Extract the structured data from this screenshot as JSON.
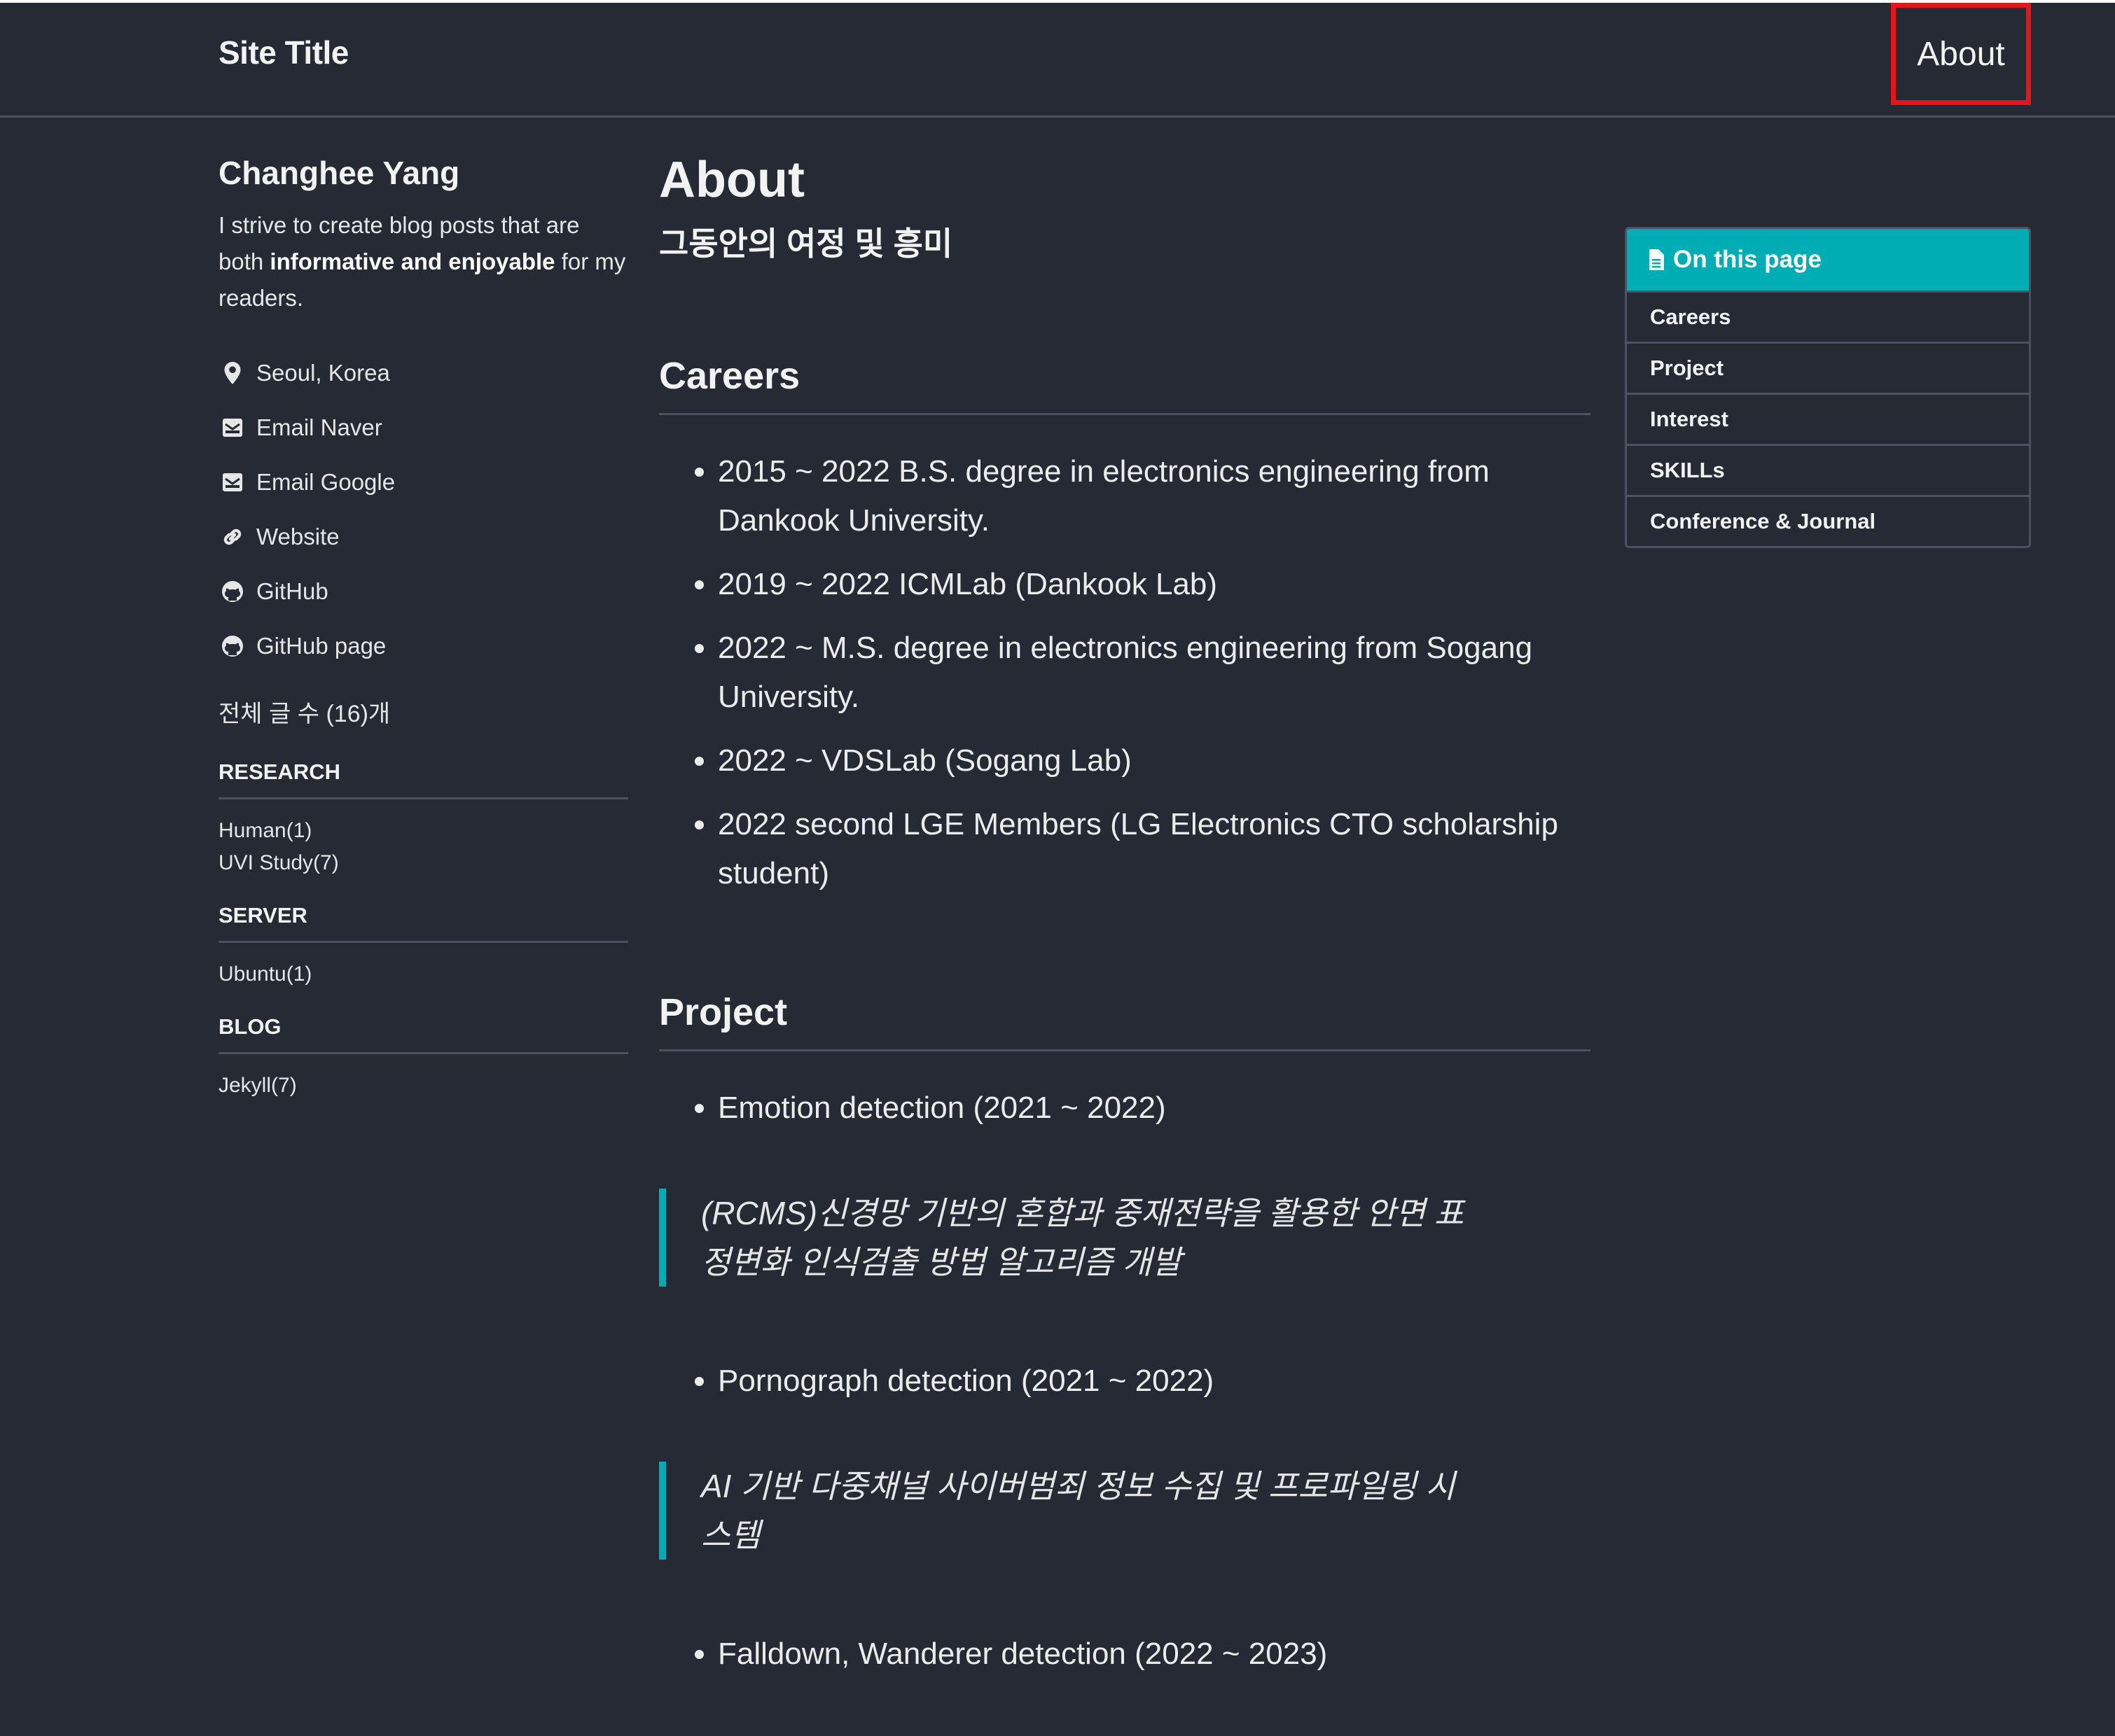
{
  "masthead": {
    "site_title": "Site Title",
    "nav": [
      {
        "label": "About"
      }
    ]
  },
  "sidebar": {
    "author_name": "Changhee Yang",
    "bio_parts": [
      "I strive to create blog posts that are both ",
      "informative and enjoyable",
      " for my readers."
    ],
    "links": [
      {
        "icon": "map-marker-icon",
        "label": "Seoul, Korea"
      },
      {
        "icon": "envelope-icon",
        "label": "Email Naver"
      },
      {
        "icon": "envelope-icon",
        "label": "Email Google"
      },
      {
        "icon": "link-icon",
        "label": "Website"
      },
      {
        "icon": "github-icon",
        "label": "GitHub"
      },
      {
        "icon": "github-icon",
        "label": "GitHub page"
      }
    ],
    "post_count": "전체 글 수 (16)개",
    "categories": [
      {
        "title": "RESEARCH",
        "items": [
          "Human(1)",
          "UVI Study(7)"
        ]
      },
      {
        "title": "SERVER",
        "items": [
          "Ubuntu(1)"
        ]
      },
      {
        "title": "BLOG",
        "items": [
          "Jekyll(7)"
        ]
      }
    ]
  },
  "main": {
    "title": "About",
    "subtitle": "그동안의 여정 및 흥미",
    "sections": [
      {
        "heading": "Careers",
        "items": [
          "2015 ~ 2022 B.S. degree in electronics engineering from Dankook University.",
          "2019 ~ 2022 ICMLab (Dankook Lab)",
          "2022 ~ M.S. degree in electronics engineering from Sogang University.",
          "2022 ~ VDSLab (Sogang Lab)",
          "2022 second LGE Members (LG Electronics CTO scholarship student)"
        ]
      },
      {
        "heading": "Project",
        "projects": [
          {
            "name": "Emotion detection (2021 ~ 2022)",
            "quote": "(RCMS)신경망 기반의 혼합과 중재전략을 활용한 안면 표정변화 인식검출 방법 알고리즘 개발"
          },
          {
            "name": "Pornograph detection (2021 ~ 2022)",
            "quote": "AI 기반 다중채널 사이버범죄 정보 수집 및 프로파일링 시스템"
          },
          {
            "name": "Falldown, Wanderer detection (2022 ~ 2023)"
          }
        ]
      }
    ]
  },
  "toc": {
    "title": "On this page",
    "items": [
      "Careers",
      "Project",
      "Interest",
      "SKILLs",
      "Conference & Journal"
    ]
  },
  "colors": {
    "background": "#252a34",
    "accent": "#00adb5",
    "highlight_box": "#e8141b"
  }
}
